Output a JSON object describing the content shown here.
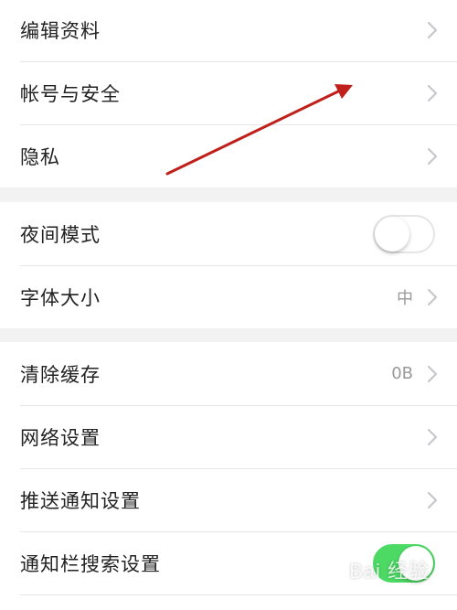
{
  "groups": [
    {
      "items": [
        {
          "label": "编辑资料",
          "control": "chevron"
        },
        {
          "label": "帐号与安全",
          "control": "chevron"
        },
        {
          "label": "隐私",
          "control": "chevron"
        }
      ]
    },
    {
      "items": [
        {
          "label": "夜间模式",
          "control": "toggle",
          "toggle_on": false
        },
        {
          "label": "字体大小",
          "value": "中",
          "control": "chevron"
        }
      ]
    },
    {
      "items": [
        {
          "label": "清除缓存",
          "value": "0B",
          "control": "chevron"
        },
        {
          "label": "网络设置",
          "control": "chevron"
        },
        {
          "label": "推送通知设置",
          "control": "chevron"
        },
        {
          "label": "通知栏搜索设置",
          "control": "toggle",
          "toggle_on": true
        }
      ]
    }
  ],
  "colors": {
    "toggle_on": "#4cd964",
    "toggle_off_border": "#e5e5e5",
    "annotation_arrow": "#c0201c",
    "label_text": "#222222",
    "value_text": "#999999"
  },
  "icons": {
    "chevron": "chevron-right-icon"
  },
  "watermark": {
    "text": "Bai 经验"
  }
}
